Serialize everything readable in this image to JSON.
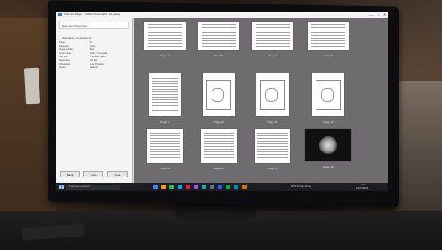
{
  "window": {
    "title": "Scanned Pages - Visible thumbnails - 16 pages",
    "controls": [
      "—",
      "□",
      "✕"
    ]
  },
  "left_panel": {
    "header": "Document Properties",
    "section": "Description of document",
    "properties": [
      {
        "k": "Pages",
        "v": "16"
      },
      {
        "k": "Page size",
        "v": "Letter"
      },
      {
        "k": "Image quality",
        "v": "Best"
      },
      {
        "k": "Color mode",
        "v": "Color / Grayscale"
      },
      {
        "k": "File type",
        "v": "Scanned Pages"
      },
      {
        "k": "Resolution",
        "v": "300 dpi"
      },
      {
        "k": "Orientation",
        "v": "Auto (Portrait)"
      },
      {
        "k": "Source",
        "v": "Flatbed"
      }
    ],
    "buttons": [
      "Back",
      "Scan",
      "Save"
    ]
  },
  "pages": [
    {
      "label": "Page 5",
      "kind": "table"
    },
    {
      "label": "Page 6",
      "kind": "table"
    },
    {
      "label": "Page 7",
      "kind": "table"
    },
    {
      "label": "Page 8",
      "kind": "table"
    },
    {
      "label": "Page 9",
      "kind": "text"
    },
    {
      "label": "Page 10",
      "kind": "drawing"
    },
    {
      "label": "Page 11",
      "kind": "drawing"
    },
    {
      "label": "Page 12",
      "kind": "drawing"
    },
    {
      "label": "Page 13",
      "kind": "text"
    },
    {
      "label": "Page 14",
      "kind": "text"
    },
    {
      "label": "Page 15",
      "kind": "text"
    },
    {
      "label": "Page 16",
      "kind": "photo"
    }
  ],
  "taskbar": {
    "search_placeholder": "Type here to search",
    "weather": "63°F  Mostly cloudy",
    "time": "11:41",
    "date": "10/17/2023",
    "icon_colors": [
      "#3b82f6",
      "#f59e0b",
      "#22c55e",
      "#0ea5e9",
      "#e11d48",
      "#a855f7",
      "#14b8a6",
      "#64748b",
      "#2563eb",
      "#16a34a",
      "#0891b2",
      "#d97706"
    ]
  }
}
